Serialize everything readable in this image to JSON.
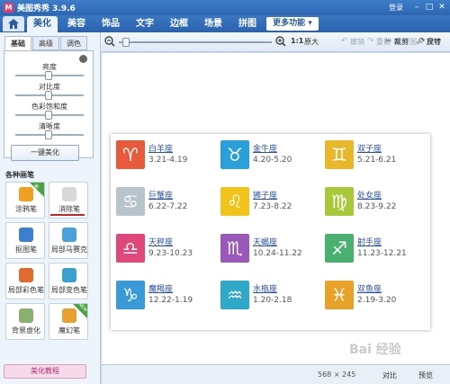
{
  "window": {
    "title": "美图秀秀 3.9.6",
    "login": "登录"
  },
  "nav": {
    "tabs": [
      "美化",
      "美容",
      "饰品",
      "文字",
      "边框",
      "场景",
      "拼图"
    ],
    "more": "更多功能 ▾",
    "active": "美化"
  },
  "toolbar": {
    "ratio": "1:1",
    "original_size": "原大",
    "undo": "撤销",
    "redo": "重做",
    "original": "原图",
    "rotate": "旋转",
    "crop": "裁剪",
    "resize": "尺寸"
  },
  "left": {
    "subtabs": [
      "基础",
      "高级",
      "调色"
    ],
    "adjust": [
      "亮度",
      "对比度",
      "色彩饱和度",
      "清晰度"
    ],
    "onekey": "一键美化",
    "section_title": "各种画笔",
    "tools": [
      {
        "label": "涂鸦笔",
        "icon": "doodle-pen-icon",
        "color": "#f0a020",
        "badge": "新"
      },
      {
        "label": "消除笔",
        "icon": "eraser-icon",
        "color": "#d0d0d0",
        "badge": ""
      },
      {
        "label": "抠图笔",
        "icon": "cutout-pen-icon",
        "color": "#3b7fd0",
        "badge": ""
      },
      {
        "label": "局部马赛克",
        "icon": "mosaic-icon",
        "color": "#4aa0d8",
        "badge": ""
      },
      {
        "label": "局部彩色笔",
        "icon": "color-pen-icon",
        "color": "#e06a30",
        "badge": ""
      },
      {
        "label": "局部变色笔",
        "icon": "recolor-pen-icon",
        "color": "#3aa0d0",
        "badge": ""
      },
      {
        "label": "背景虚化",
        "icon": "blur-bg-icon",
        "color": "#8ab070",
        "badge": ""
      },
      {
        "label": "魔幻笔",
        "icon": "magic-pen-icon",
        "color": "#e8a030",
        "badge": "NEW"
      }
    ],
    "tutorial": "美化教程"
  },
  "zodiac": [
    {
      "name": "白羊座",
      "dates": "3.21-4.19",
      "glyph": "♈",
      "color": "#e85a3c"
    },
    {
      "name": "金牛座",
      "dates": "4.20-5.20",
      "glyph": "♉",
      "color": "#2aa0d8"
    },
    {
      "name": "双子座",
      "dates": "5.21-6.21",
      "glyph": "♊",
      "color": "#e8b82a"
    },
    {
      "name": "巨蟹座",
      "dates": "6.22-7.22",
      "glyph": "♋",
      "color": "#b8c4cc"
    },
    {
      "name": "狮子座",
      "dates": "7.23-8.22",
      "glyph": "♌",
      "color": "#f0c418"
    },
    {
      "name": "处女座",
      "dates": "8.23-9.22",
      "glyph": "♍",
      "color": "#a8c838"
    },
    {
      "name": "天秤座",
      "dates": "9.23-10.23",
      "glyph": "♎",
      "color": "#e0487c"
    },
    {
      "name": "天蝎座",
      "dates": "10.24-11.22",
      "glyph": "♏",
      "color": "#9a58b8"
    },
    {
      "name": "射手座",
      "dates": "11.23-12.21",
      "glyph": "♐",
      "color": "#4ab070"
    },
    {
      "name": "魔羯座",
      "dates": "12.22-1.19",
      "glyph": "♑",
      "color": "#3a9ad8"
    },
    {
      "name": "水瓶座",
      "dates": "1.20-2.18",
      "glyph": "♒",
      "color": "#30a8c8"
    },
    {
      "name": "双鱼座",
      "dates": "2.19-3.20",
      "glyph": "♓",
      "color": "#e8a22a"
    }
  ],
  "status": {
    "dimensions": "568 × 245",
    "compare": "对比",
    "preview": "预览"
  },
  "watermark": "Bai 经验"
}
